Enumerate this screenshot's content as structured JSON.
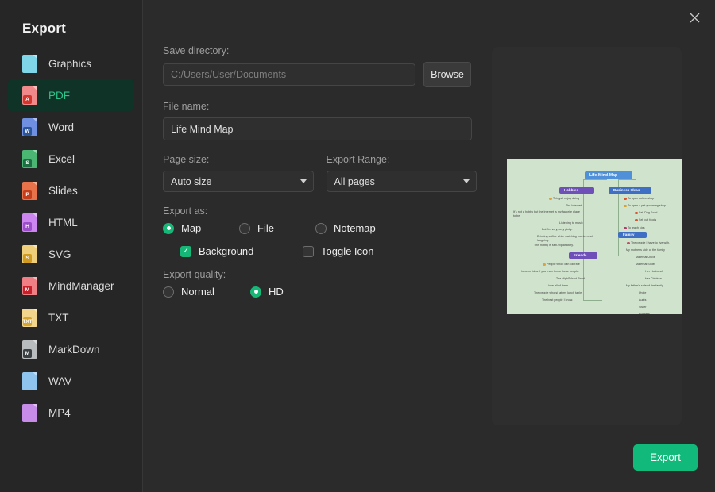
{
  "sidebar": {
    "title": "Export",
    "items": [
      {
        "label": "Graphics",
        "icon": "graphics-file-icon",
        "tag": "",
        "color": "#7fd6e8",
        "accent": "#2a9fc4",
        "active": false
      },
      {
        "label": "PDF",
        "icon": "pdf-file-icon",
        "tag": "A",
        "color": "#f08a8a",
        "accent": "#d4362c",
        "active": true
      },
      {
        "label": "Word",
        "icon": "word-file-icon",
        "tag": "W",
        "color": "#6f8fe0",
        "accent": "#2b579a",
        "active": false
      },
      {
        "label": "Excel",
        "icon": "excel-file-icon",
        "tag": "S",
        "color": "#4bb573",
        "accent": "#1d6f42",
        "active": false
      },
      {
        "label": "Slides",
        "icon": "slides-file-icon",
        "tag": "P",
        "color": "#e8724a",
        "accent": "#c43e1c",
        "active": false
      },
      {
        "label": "HTML",
        "icon": "html-file-icon",
        "tag": "H",
        "color": "#cd86ef",
        "accent": "#9b4dca",
        "active": false
      },
      {
        "label": "SVG",
        "icon": "svg-file-icon",
        "tag": "S",
        "color": "#f0cf7a",
        "accent": "#d19b20",
        "active": false
      },
      {
        "label": "MindManager",
        "icon": "mindmanager-file-icon",
        "tag": "M",
        "color": "#ef7f84",
        "accent": "#c8202a",
        "active": false
      },
      {
        "label": "TXT",
        "icon": "txt-file-icon",
        "tag": "TXT",
        "color": "#f2d68c",
        "accent": "#d8a62c",
        "active": false
      },
      {
        "label": "MarkDown",
        "icon": "markdown-file-icon",
        "tag": "M",
        "color": "#b9bcbe",
        "accent": "#3a3f43",
        "active": false
      },
      {
        "label": "WAV",
        "icon": "wav-file-icon",
        "tag": "",
        "color": "#8fc4ee",
        "accent": "#1f7fc4",
        "active": false
      },
      {
        "label": "MP4",
        "icon": "mp4-file-icon",
        "tag": "",
        "color": "#c78ce8",
        "accent": "#8b34c0",
        "active": false
      }
    ]
  },
  "titlebar": {
    "close_icon": "close-icon"
  },
  "form": {
    "save_directory_label": "Save directory:",
    "save_directory_value": "C:/Users/User/Documents",
    "save_directory_is_placeholder": true,
    "browse_label": "Browse",
    "file_name_label": "File name:",
    "file_name_value": "Life Mind Map",
    "page_size_label": "Page size:",
    "page_size_value": "Auto size",
    "page_size_options": [
      "Auto size"
    ],
    "export_range_label": "Export Range:",
    "export_range_value": "All pages",
    "export_range_options": [
      "All pages"
    ],
    "export_as_label": "Export as:",
    "export_as_options": [
      {
        "label": "Map",
        "selected": true
      },
      {
        "label": "File",
        "selected": false
      },
      {
        "label": "Notemap",
        "selected": false
      }
    ],
    "checkboxes": [
      {
        "label": "Background",
        "checked": true,
        "check_glyph": "✓"
      },
      {
        "label": "Toggle Icon",
        "checked": false,
        "check_glyph": "✓"
      }
    ],
    "export_quality_label": "Export quality:",
    "export_quality_options": [
      {
        "label": "Normal",
        "selected": false
      },
      {
        "label": "HD",
        "selected": true
      }
    ]
  },
  "preview": {
    "mindmap": {
      "root": "Life-Mind-Map",
      "branches": [
        {
          "title": "Hobbies",
          "leaves": [
            "Things I enjoy doing",
            "The Internet",
            "It's not a hobby but the Internet is my favorite place to be.",
            "Listening to music",
            "But I'm very, very picky.",
            "Drinking coffee while watching movies and laughing.",
            "This hobby is self-explanatory."
          ]
        },
        {
          "title": "Business Ideas",
          "leaves": [
            "To open coffee shop",
            "To open a pet grooming shop",
            "Sell Dog Food",
            "Sell cat foods",
            "To teach kids"
          ]
        },
        {
          "title": "Family",
          "leaves": [
            "The people I have to live with.",
            "My mother's side of the family",
            "Maternal Uncle",
            "Maternal Sister",
            "Her Husband",
            "Her Children",
            "My father's side of the family",
            "Uncle",
            "Aunts",
            "Sister",
            "Brothers"
          ]
        },
        {
          "title": "Friends",
          "leaves": [
            "People who I can tolerate",
            "I have no idea if you even know these people.",
            "The HighSchool Band",
            "I love all of them.",
            "The people who sit at my lunch table.",
            "The best people I know."
          ]
        }
      ]
    }
  },
  "footer": {
    "export_label": "Export"
  },
  "colors": {
    "accent_green": "#11b97a",
    "active_row_bg": "#0f3326",
    "active_row_text": "#2fc38a",
    "dialog_bg": "#2b2b2b",
    "sidebar_bg": "#262626",
    "map_bg": "#cfe3cd"
  }
}
